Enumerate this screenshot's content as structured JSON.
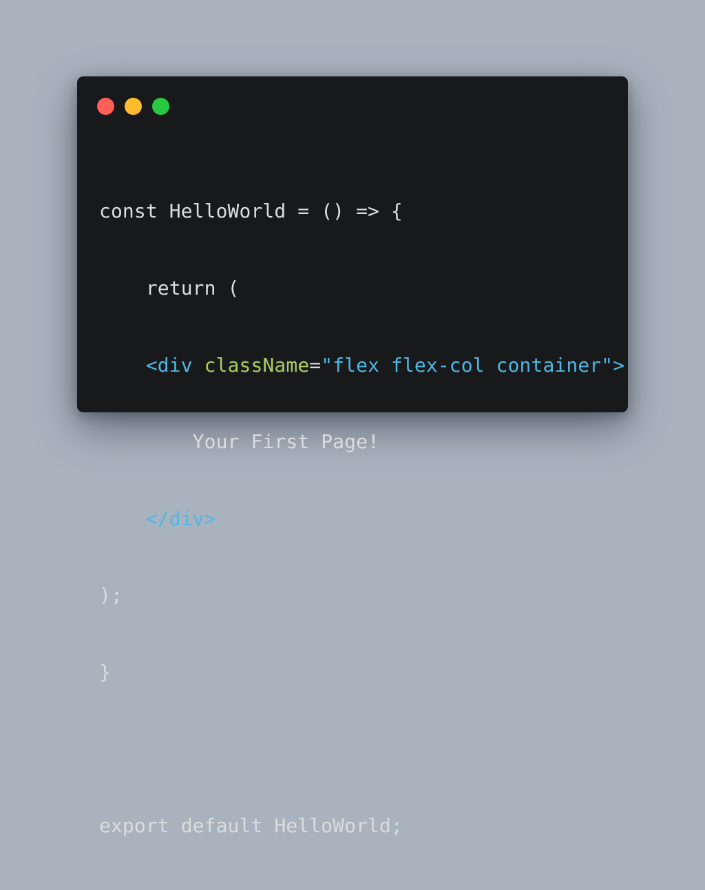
{
  "colors": {
    "background": "#a9b3be",
    "window": "#18191b",
    "text": "#dcdcdc",
    "tag": "#4fb6e4",
    "attribute": "#a8cc63",
    "string": "#4fb6e4",
    "close": "#ff5f56",
    "minimize": "#ffbd2e",
    "maximize": "#27c93f"
  },
  "window_controls": [
    "close",
    "minimize",
    "maximize"
  ],
  "code": {
    "line1": "const HelloWorld = () => {",
    "line2_indent": "    ",
    "line2": "return (",
    "line3_indent": "    ",
    "line3_open": "<div",
    "line3_space": " ",
    "line3_attr": "className",
    "line3_eq": "=",
    "line3_value": "\"flex flex-col container\"",
    "line3_close": ">",
    "line4_indent": "        ",
    "line4": "Your First Page!",
    "line5_indent": "    ",
    "line5": "</div>",
    "line6": ");",
    "line7": "}",
    "line8": "",
    "line9": "export default HelloWorld;"
  }
}
